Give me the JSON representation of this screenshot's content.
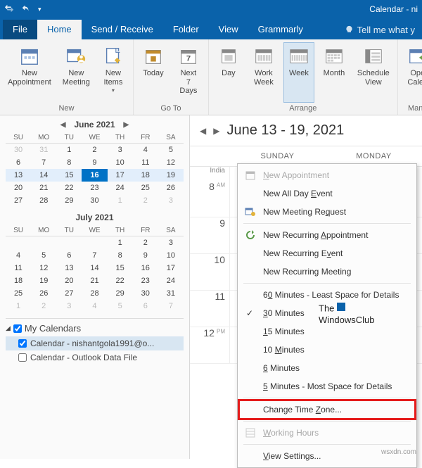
{
  "titlebar": {
    "title": "Calendar - ni"
  },
  "tabs": {
    "file": "File",
    "home": "Home",
    "sendreceive": "Send / Receive",
    "folder": "Folder",
    "view": "View",
    "grammarly": "Grammarly",
    "tell": "Tell me what y"
  },
  "ribbon": {
    "new": {
      "label": "New",
      "appointment": "New\nAppointment",
      "meeting": "New\nMeeting",
      "items": "New\nItems"
    },
    "goto": {
      "label": "Go To",
      "today": "Today",
      "next7": "Next\n7 Days"
    },
    "arrange": {
      "label": "Arrange",
      "day": "Day",
      "workweek": "Work\nWeek",
      "week": "Week",
      "month": "Month",
      "schedule": "Schedule\nView"
    },
    "manage": {
      "label": "Mana",
      "open": "Ope\nCalen"
    }
  },
  "minical1": {
    "title": "June 2021",
    "dow": [
      "SU",
      "MO",
      "TU",
      "WE",
      "TH",
      "FR",
      "SA"
    ],
    "rows": [
      [
        {
          "d": 30,
          "dim": true
        },
        {
          "d": 31,
          "dim": true
        },
        {
          "d": 1
        },
        {
          "d": 2
        },
        {
          "d": 3
        },
        {
          "d": 4
        },
        {
          "d": 5
        }
      ],
      [
        {
          "d": 6
        },
        {
          "d": 7
        },
        {
          "d": 8
        },
        {
          "d": 9
        },
        {
          "d": 10
        },
        {
          "d": 11
        },
        {
          "d": 12
        }
      ],
      [
        {
          "d": 13,
          "wk": true
        },
        {
          "d": 14,
          "wk": true
        },
        {
          "d": 15,
          "wk": true
        },
        {
          "d": 16,
          "today": true
        },
        {
          "d": 17,
          "wk": true
        },
        {
          "d": 18,
          "wk": true
        },
        {
          "d": 19,
          "wk": true
        }
      ],
      [
        {
          "d": 20
        },
        {
          "d": 21
        },
        {
          "d": 22
        },
        {
          "d": 23
        },
        {
          "d": 24
        },
        {
          "d": 25
        },
        {
          "d": 26
        }
      ],
      [
        {
          "d": 27
        },
        {
          "d": 28
        },
        {
          "d": 29
        },
        {
          "d": 30
        },
        {
          "d": 1,
          "dim": true
        },
        {
          "d": 2,
          "dim": true
        },
        {
          "d": 3,
          "dim": true
        }
      ]
    ]
  },
  "minical2": {
    "title": "July 2021",
    "dow": [
      "SU",
      "MO",
      "TU",
      "WE",
      "TH",
      "FR",
      "SA"
    ],
    "rows": [
      [
        {
          "d": ""
        },
        {
          "d": ""
        },
        {
          "d": ""
        },
        {
          "d": ""
        },
        {
          "d": 1
        },
        {
          "d": 2
        },
        {
          "d": 3
        }
      ],
      [
        {
          "d": 4
        },
        {
          "d": 5
        },
        {
          "d": 6
        },
        {
          "d": 7
        },
        {
          "d": 8
        },
        {
          "d": 9
        },
        {
          "d": 10
        }
      ],
      [
        {
          "d": 11
        },
        {
          "d": 12
        },
        {
          "d": 13
        },
        {
          "d": 14
        },
        {
          "d": 15
        },
        {
          "d": 16
        },
        {
          "d": 17
        }
      ],
      [
        {
          "d": 18
        },
        {
          "d": 19
        },
        {
          "d": 20
        },
        {
          "d": 21
        },
        {
          "d": 22
        },
        {
          "d": 23
        },
        {
          "d": 24
        }
      ],
      [
        {
          "d": 25
        },
        {
          "d": 26
        },
        {
          "d": 27
        },
        {
          "d": 28
        },
        {
          "d": 29
        },
        {
          "d": 30
        },
        {
          "d": 31
        }
      ],
      [
        {
          "d": 1,
          "dim": true
        },
        {
          "d": 2,
          "dim": true
        },
        {
          "d": 3,
          "dim": true
        },
        {
          "d": 4,
          "dim": true
        },
        {
          "d": 5,
          "dim": true
        },
        {
          "d": 6,
          "dim": true
        },
        {
          "d": 7,
          "dim": true
        }
      ]
    ]
  },
  "mycals": {
    "header": "My Calendars",
    "items": [
      {
        "label": "Calendar - nishantgola1991@o...",
        "checked": true,
        "sel": true
      },
      {
        "label": "Calendar - Outlook Data File",
        "checked": false,
        "sel": false
      }
    ]
  },
  "calhdr": {
    "range": "June 13 - 19, 2021",
    "sunday": "SUNDAY",
    "monday": "MONDAY"
  },
  "timescale": {
    "tz": "India",
    "slots": [
      "8",
      "9",
      "10",
      "11",
      "12"
    ],
    "ampm": [
      "AM",
      "",
      "",
      "",
      "PM"
    ]
  },
  "ctx": {
    "new_appt": "New Appointment",
    "new_allday": "New All Day Event",
    "new_meeting": "New Meeting Request",
    "new_recur_appt": "New Recurring Appointment",
    "new_recur_event": "New Recurring Event",
    "new_recur_meeting": "New Recurring Meeting",
    "m60": "60 Minutes - Least Space for Details",
    "m30": "30 Minutes",
    "m15": "15 Minutes",
    "m10": "10 Minutes",
    "m6": "6 Minutes",
    "m5": "5 Minutes - Most Space for Details",
    "change_tz": "Change Time Zone...",
    "working_hours": "Working Hours",
    "view_settings": "View Settings..."
  },
  "watermark": "wsxdn.com",
  "wmlogo": {
    "l1": "The",
    "l2": "WindowsClub"
  }
}
